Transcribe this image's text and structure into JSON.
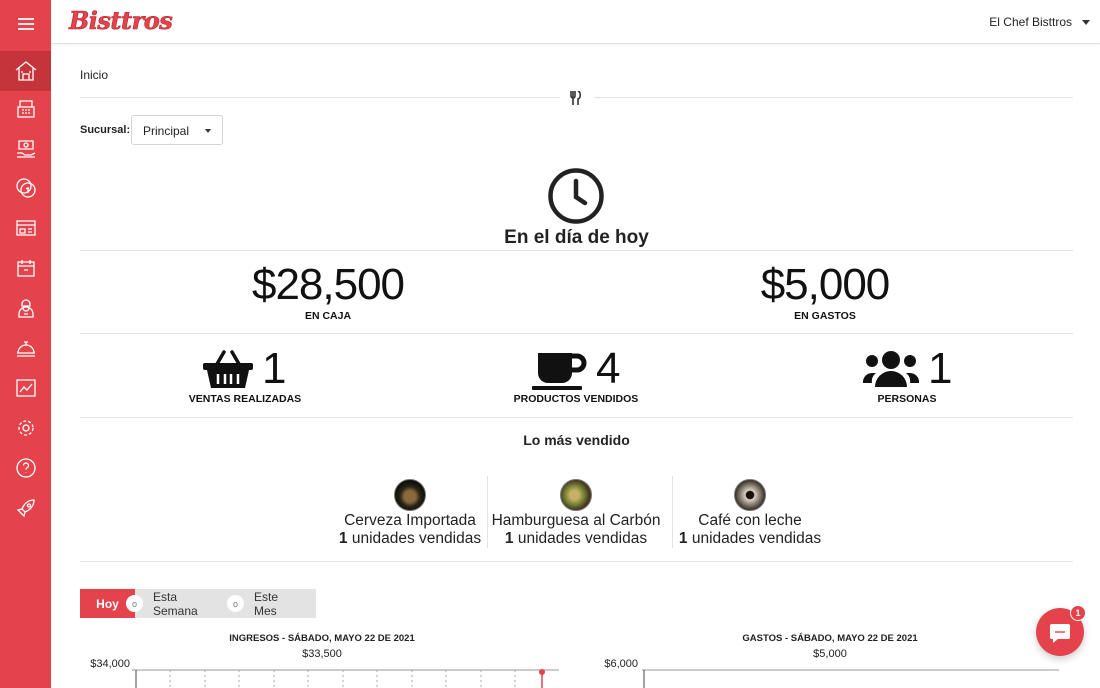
{
  "app": {
    "brand": "Bisttros",
    "user_name": "El Chef Bisttros"
  },
  "sidebar": {
    "items": [
      {
        "icon": "home-icon",
        "active": true
      },
      {
        "icon": "cash-register-icon"
      },
      {
        "icon": "money-hand-icon"
      },
      {
        "icon": "coins-icon"
      },
      {
        "icon": "kitchen-icon"
      },
      {
        "icon": "calendar-icon"
      },
      {
        "icon": "chef-icon"
      },
      {
        "icon": "cloche-icon"
      },
      {
        "icon": "reports-chart-icon"
      },
      {
        "icon": "settings-gear-icon"
      },
      {
        "icon": "help-question-icon"
      },
      {
        "icon": "rocket-icon"
      }
    ]
  },
  "breadcrumb": "Inicio",
  "branch": {
    "label": "Sucursal:",
    "selected": "Principal"
  },
  "today": {
    "title": "En el día de hoy"
  },
  "totals": {
    "cash": {
      "value": "$28,500",
      "label": "EN CAJA"
    },
    "expenses": {
      "value": "$5,000",
      "label": "EN GASTOS"
    }
  },
  "stats": {
    "sales": {
      "value": "1",
      "label": "VENTAS REALIZADAS"
    },
    "products": {
      "value": "4",
      "label": "PRODUCTOS VENDIDOS"
    },
    "people": {
      "value": "1",
      "label": "PERSONAS"
    }
  },
  "best_sellers": {
    "title": "Lo más vendido",
    "items": [
      {
        "name": "Cerveza Importada",
        "count": "1",
        "units_label": " unidades vendidas"
      },
      {
        "name": "Hamburguesa al Carbón",
        "count": "1",
        "units_label": " unidades vendidas"
      },
      {
        "name": "Café con leche",
        "count": "1",
        "units_label": " unidades vendidas"
      }
    ]
  },
  "period_tabs": [
    {
      "label": "Hoy",
      "active": true
    },
    {
      "label": "Esta Semana",
      "bubble": "o"
    },
    {
      "label": "Este Mes",
      "bubble": "o"
    }
  ],
  "charts": {
    "income": {
      "title": "INGRESOS - SÁBADO, MAYO 22 DE 2021",
      "total": "$33,500",
      "y_top": "$34,000"
    },
    "expenses": {
      "title": "GASTOS - SÁBADO, MAYO 22 DE 2021",
      "total": "$5,000",
      "y_top": "$6,000"
    }
  },
  "chat": {
    "badge": "1"
  },
  "colors": {
    "accent": "#e4434b",
    "accent_dark": "#c6343b"
  }
}
